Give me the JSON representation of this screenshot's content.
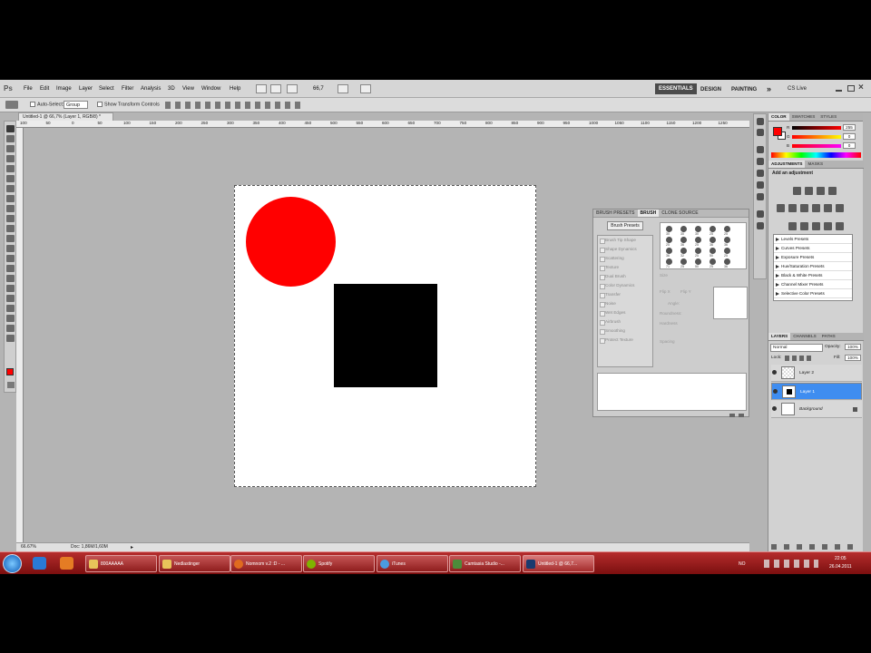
{
  "menu": {
    "logo": "Ps",
    "items": [
      "File",
      "Edit",
      "Image",
      "Layer",
      "Select",
      "Filter",
      "Analysis",
      "3D",
      "View",
      "Window",
      "Help"
    ],
    "zoom": "66,7",
    "workspaces": [
      "ESSENTIALS",
      "DESIGN",
      "PAINTING"
    ],
    "more": "»",
    "cslive": "CS Live"
  },
  "options": {
    "auto_select": "Auto-Select:",
    "auto_select_value": "Group",
    "transform": "Show Transform Controls"
  },
  "document": {
    "tab_title": "Untitled-1 @ 66,7% (Layer 1, RGB/8) *",
    "ruler_ticks": [
      "100",
      "50",
      "0",
      "50",
      "100",
      "150",
      "200",
      "250",
      "300",
      "350",
      "400",
      "450",
      "500",
      "550",
      "600",
      "650",
      "700",
      "750",
      "800",
      "850",
      "900",
      "950",
      "1000",
      "1050",
      "1100",
      "1150",
      "1200",
      "1250"
    ],
    "zoom_status": "66.67%",
    "doc_status": "Doc: 1,86M/1,60M"
  },
  "brush_panel": {
    "tabs": [
      "BRUSH PRESETS",
      "BRUSH",
      "CLONE SOURCE"
    ],
    "active_tab": "BRUSH",
    "button": "Brush Presets",
    "options": [
      "Brush Tip Shape",
      "Shape Dynamics",
      "Scattering",
      "Texture",
      "Dual Brush",
      "Color Dynamics",
      "Transfer",
      "Noise",
      "Wet Edges",
      "Airbrush",
      "Smoothing",
      "Protect Texture"
    ],
    "tip_sizes": [
      "30",
      "30",
      "30",
      "25",
      "25",
      "25",
      "36",
      "25",
      "36",
      "36",
      "36",
      "32",
      "25",
      "50",
      "25",
      "71",
      "25",
      "50",
      "25",
      "36"
    ],
    "fields": {
      "size": "Size",
      "flip_x": "Flip X",
      "flip_y": "Flip Y",
      "angle": "Angle:",
      "roundness": "Roundness:",
      "hardness": "Hardness",
      "spacing": "Spacing"
    }
  },
  "color_panel": {
    "tabs": [
      "COLOR",
      "SWATCHES",
      "STYLES"
    ],
    "channels": [
      {
        "label": "R",
        "value": "255"
      },
      {
        "label": "G",
        "value": "0"
      },
      {
        "label": "B",
        "value": "0"
      }
    ],
    "foreground": "#ff0000"
  },
  "adjustments_panel": {
    "tabs": [
      "ADJUSTMENTS",
      "MASKS"
    ],
    "title": "Add an adjustment",
    "presets": [
      "Levels Presets",
      "Curves Presets",
      "Exposure Presets",
      "Hue/Saturation Presets",
      "Black & White Presets",
      "Channel Mixer Presets",
      "Selective Color Presets"
    ]
  },
  "layers_panel": {
    "tabs": [
      "LAYERS",
      "CHANNELS",
      "PATHS"
    ],
    "blend": "Normal",
    "opacity_label": "Opacity:",
    "opacity": "100%",
    "lock_label": "Lock:",
    "fill_label": "Fill:",
    "fill": "100%",
    "layers": [
      {
        "name": "Layer 2",
        "selected": false
      },
      {
        "name": "Layer 1",
        "selected": true
      },
      {
        "name": "Background",
        "selected": false
      }
    ]
  },
  "taskbar": {
    "tasks": [
      "800AAAAA",
      "Nedlastinger",
      "Nomnom v.2 :D - ...",
      "Spotify",
      "iTunes",
      "Camtasia Studio -...",
      "Untitled-1 @ 66,7..."
    ],
    "lang": "NO",
    "time": "22:05",
    "date": "26.04.2011"
  }
}
